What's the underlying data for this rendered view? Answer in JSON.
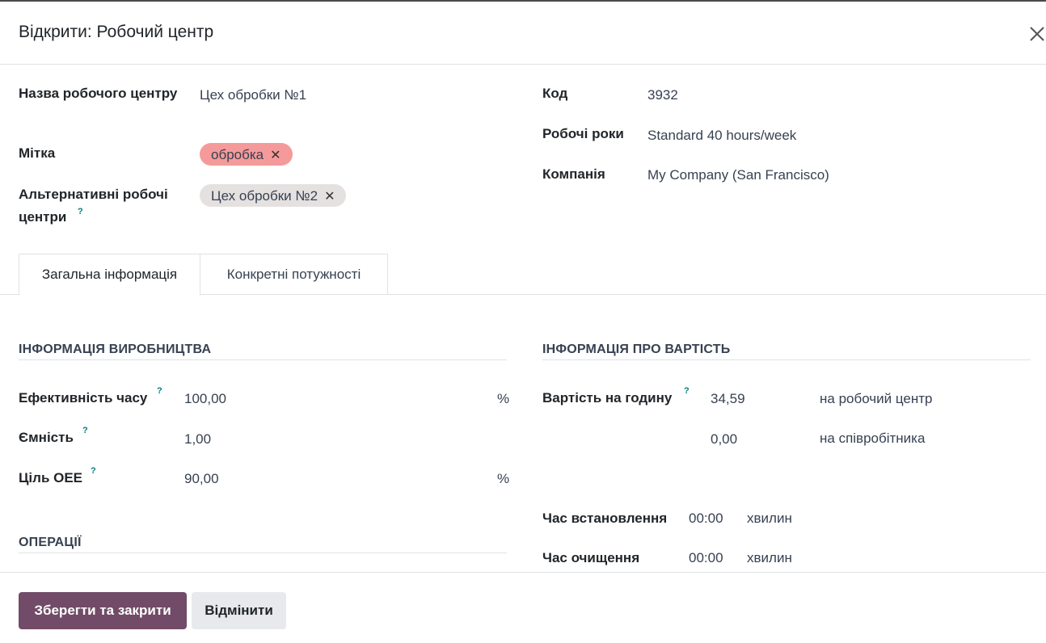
{
  "dialog": {
    "title": "Відкрити: Робочий центр",
    "close_icon": "close-icon"
  },
  "fields": {
    "name_label": "Назва робочого центру",
    "name_value": "Цех обробки №1",
    "tag_label": "Мітка",
    "tag_value": "обробка",
    "alt_label": "Альтернативні робочі центри",
    "alt_value": "Цех обробки №2",
    "code_label": "Код",
    "code_value": "3932",
    "hours_label": "Робочі роки",
    "hours_value": "Standard 40 hours/week",
    "company_label": "Компанія",
    "company_value": "My Company (San Francisco)"
  },
  "tabs": [
    {
      "label": "Загальна інформація",
      "active": true
    },
    {
      "label": "Конкретні потужності",
      "active": false
    }
  ],
  "production": {
    "title": "ІНФОРМАЦІЯ ВИРОБНИЦТВА",
    "efficiency_label": "Ефективність часу",
    "efficiency_value": "100,00",
    "efficiency_unit": "%",
    "capacity_label": "Ємність",
    "capacity_value": "1,00",
    "oee_label": "Ціль OEE",
    "oee_value": "90,00",
    "oee_unit": "%"
  },
  "operations": {
    "title": "ОПЕРАЦІЇ"
  },
  "cost": {
    "title": "ІНФОРМАЦІЯ ПРО ВАРТІСТЬ",
    "per_hour_label": "Вартість на годину",
    "per_hour_value": "34,59",
    "per_hour_unit": "на робочий центр",
    "per_employee_value": "0,00",
    "per_employee_unit": "на співробітника",
    "setup_label": "Час встановлення",
    "setup_value": "00:00",
    "setup_unit": "хвилин",
    "cleanup_label": "Час очищення",
    "cleanup_value": "00:00",
    "cleanup_unit": "хвилин"
  },
  "help_mark": "?",
  "tag_remove": "✕",
  "footer": {
    "save_label": "Зберегти та закрити",
    "cancel_label": "Відмінити"
  },
  "colors": {
    "primary": "#714b67",
    "tag_pink": "#f59a9a",
    "tag_gray": "#e5e1e1",
    "help": "#017e84"
  }
}
